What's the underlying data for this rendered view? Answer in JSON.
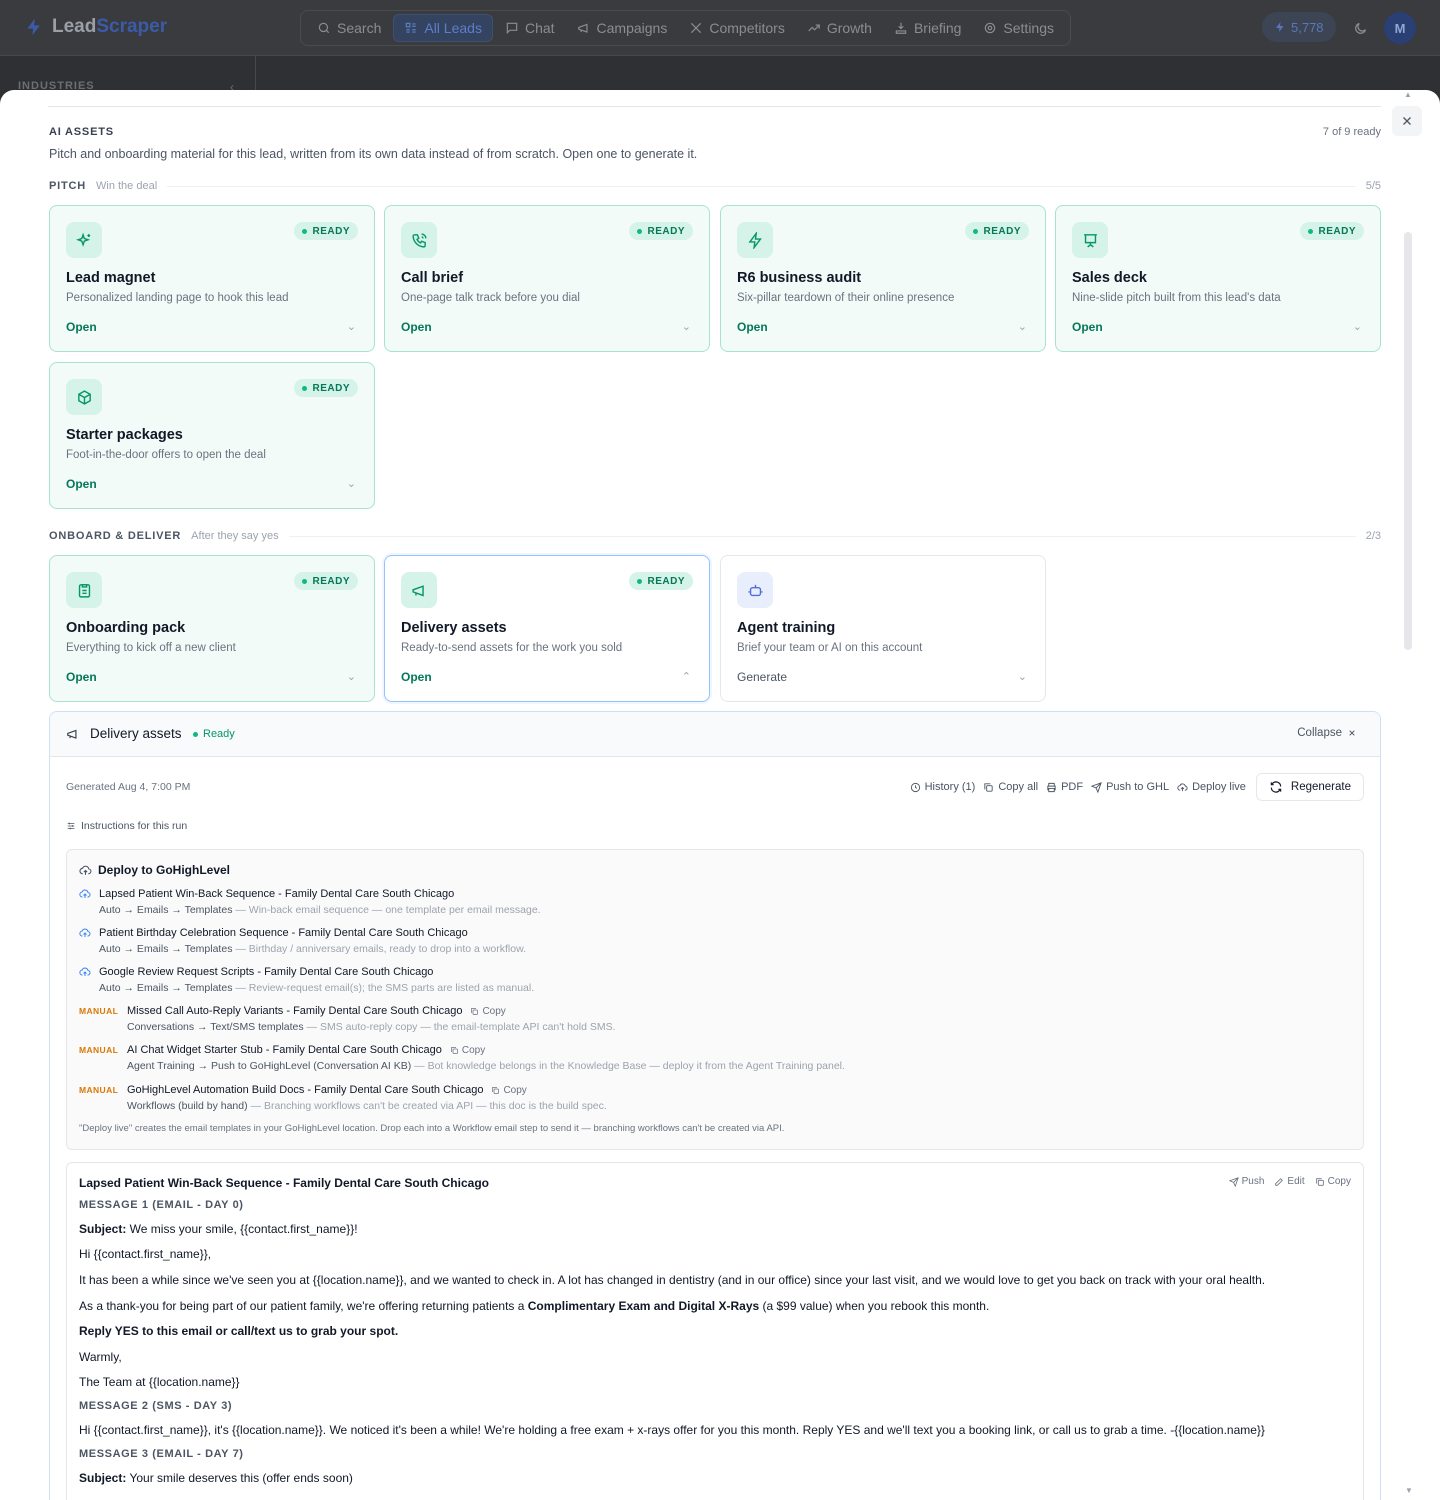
{
  "app": {
    "brand_first": "Lead",
    "brand_second": "Scraper",
    "nav": [
      {
        "label": "Search",
        "icon": "search-icon"
      },
      {
        "label": "All Leads",
        "icon": "grid-icon",
        "active": true
      },
      {
        "label": "Chat",
        "icon": "chat-icon"
      },
      {
        "label": "Campaigns",
        "icon": "megaphone-icon"
      },
      {
        "label": "Competitors",
        "icon": "swords-icon"
      },
      {
        "label": "Growth",
        "icon": "trend-icon"
      },
      {
        "label": "Briefing",
        "icon": "briefing-icon"
      },
      {
        "label": "Settings",
        "icon": "gear-icon"
      }
    ],
    "credits": "5,778",
    "avatar": "M",
    "sidebar_label": "INDUSTRIES"
  },
  "assets": {
    "title": "AI ASSETS",
    "count": "7 of 9 ready",
    "description": "Pitch and onboarding material for this lead, written from its own data instead of from scratch. Open one to generate it.",
    "groups": {
      "pitch": {
        "name": "PITCH",
        "sub": "Win the deal",
        "count": "5/5"
      },
      "onboard": {
        "name": "ONBOARD & DELIVER",
        "sub": "After they say yes",
        "count": "2/3"
      }
    },
    "ready_label": "READY",
    "cards": [
      {
        "title": "Lead magnet",
        "desc": "Personalized landing page to hook this lead",
        "action": "Open",
        "icon": "sparkles-icon"
      },
      {
        "title": "Call brief",
        "desc": "One-page talk track before you dial",
        "action": "Open",
        "icon": "phone-icon"
      },
      {
        "title": "R6 business audit",
        "desc": "Six-pillar teardown of their online presence",
        "action": "Open",
        "icon": "bolt-icon"
      },
      {
        "title": "Sales deck",
        "desc": "Nine-slide pitch built from this lead's data",
        "action": "Open",
        "icon": "presentation-icon"
      },
      {
        "title": "Starter packages",
        "desc": "Foot-in-the-door offers to open the deal",
        "action": "Open",
        "icon": "package-icon"
      },
      {
        "title": "Onboarding pack",
        "desc": "Everything to kick off a new client",
        "action": "Open",
        "icon": "clipboard-icon"
      },
      {
        "title": "Delivery assets",
        "desc": "Ready-to-send assets for the work you sold",
        "action": "Open",
        "icon": "megaphone-icon"
      },
      {
        "title": "Agent training",
        "desc": "Brief your team or AI on this account",
        "action": "Generate",
        "icon": "bot-icon"
      }
    ]
  },
  "panel": {
    "title": "Delivery assets",
    "status": "Ready",
    "collapse": "Collapse",
    "generated": "Generated Aug 4, 7:00 PM",
    "actions": {
      "history": "History (1)",
      "copy_all": "Copy all",
      "pdf": "PDF",
      "push": "Push to GHL",
      "deploy": "Deploy live",
      "regenerate": "Regenerate"
    },
    "instructions": "Instructions for this run",
    "deploy": {
      "title": "Deploy to GoHighLevel",
      "manual_label": "MANUAL",
      "copy_label": "Copy",
      "rows": [
        {
          "type": "auto",
          "name": "Lapsed Patient Win-Back Sequence - Family Dental Care South Chicago",
          "path": "Auto → Emails → Templates",
          "note": " — Win-back email sequence — one template per email message."
        },
        {
          "type": "auto",
          "name": "Patient Birthday Celebration Sequence - Family Dental Care South Chicago",
          "path": "Auto → Emails → Templates",
          "note": " — Birthday / anniversary emails, ready to drop into a workflow."
        },
        {
          "type": "auto",
          "name": "Google Review Request Scripts - Family Dental Care South Chicago",
          "path": "Auto → Emails → Templates",
          "note": " — Review-request email(s); the SMS parts are listed as manual."
        },
        {
          "type": "manual",
          "name": "Missed Call Auto-Reply Variants - Family Dental Care South Chicago",
          "path": "Conversations → Text/SMS templates",
          "note": " — SMS auto-reply copy — the email-template API can't hold SMS."
        },
        {
          "type": "manual",
          "name": "AI Chat Widget Starter Stub - Family Dental Care South Chicago",
          "path": "Agent Training → Push to GoHighLevel (Conversation AI KB)",
          "note": " — Bot knowledge belongs in the Knowledge Base — deploy it from the Agent Training panel."
        },
        {
          "type": "manual",
          "name": "GoHighLevel Automation Build Docs - Family Dental Care South Chicago",
          "path": "Workflows (build by hand)",
          "note": " — Branching workflows can't be created via API — this doc is the build spec."
        }
      ],
      "footnote": "\"Deploy live\" creates the email templates in your GoHighLevel location. Drop each into a Workflow email step to send it — branching workflows can't be created via API."
    },
    "doc": {
      "title": "Lapsed Patient Win-Back Sequence - Family Dental Care South Chicago",
      "tools": {
        "push": "Push",
        "edit": "Edit",
        "copy": "Copy"
      },
      "m1": "MESSAGE 1 (EMAIL - DAY 0)",
      "subject_label": "Subject:",
      "m1_subject": " We miss your smile, {{contact.first_name}}!",
      "m1_greeting": "Hi {{contact.first_name}},",
      "m1_p1": "It has been a while since we've seen you at {{location.name}}, and we wanted to check in. A lot has changed in dentistry (and in our office) since your last visit, and we would love to get you back on track with your oral health.",
      "m1_p2a": "As a thank-you for being part of our patient family, we're offering returning patients a ",
      "m1_p2b": "Complimentary Exam and Digital X-Rays",
      "m1_p2c": " (a $99 value) when you rebook this month.",
      "m1_cta": "Reply YES to this email or call/text us to grab your spot.",
      "m1_signoff": "Warmly,",
      "m1_sign": "The Team at {{location.name}}",
      "m2": "MESSAGE 2 (SMS - DAY 3)",
      "m2_body": "Hi {{contact.first_name}}, it's {{location.name}}. We noticed it's been a while! We're holding a free exam + x-rays offer for you this month. Reply YES and we'll text you a booking link, or call us to grab a time. -{{location.name}}",
      "m3": "MESSAGE 3 (EMAIL - DAY 7)",
      "m3_subject": " Your smile deserves this (offer ends soon)"
    }
  }
}
